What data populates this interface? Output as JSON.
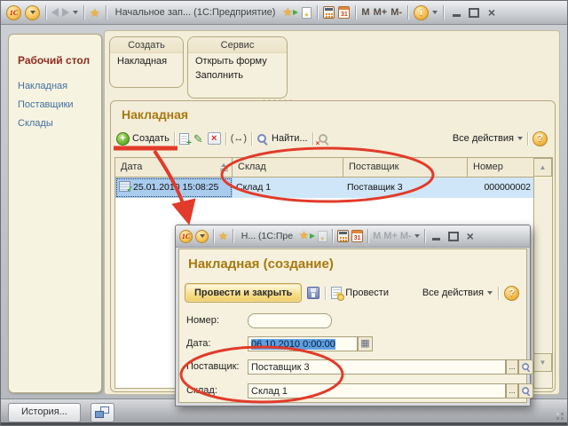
{
  "icons": {
    "logo": "1С",
    "calendar_day": "31",
    "ellipsis": "...",
    "close": "×",
    "help": "?",
    "info": "i",
    "grid": "▦",
    "resize_hint": "(↔)"
  },
  "window": {
    "title": "Начальное зап... (1С:Предприятие)",
    "m_buttons": [
      "M",
      "M+",
      "M-"
    ],
    "statusbar": {
      "history_label": "История..."
    }
  },
  "sidebar": {
    "title": "Рабочий стол",
    "links": [
      "Накладная",
      "Поставщики",
      "Склады"
    ]
  },
  "command_groups": [
    {
      "title": "Создать",
      "items": [
        "Накладная"
      ]
    },
    {
      "title": "Сервис",
      "items": [
        "Открыть форму",
        "Заполнить"
      ]
    }
  ],
  "list_panel": {
    "title": "Накладная",
    "toolbar": {
      "create_label": "Создать",
      "find_label": "Найти...",
      "all_actions_label": "Все действия"
    },
    "table": {
      "columns": [
        "Дата",
        "Склад",
        "Поставщик",
        "Номер"
      ],
      "row": {
        "date": "25.01.2010 15:08:25",
        "warehouse": "Склад 1",
        "supplier": "Поставщик 3",
        "number": "000000002"
      }
    }
  },
  "dialog": {
    "title": "Н... (1С:Пре",
    "m_buttons": [
      "M",
      "M+",
      "M-"
    ],
    "heading": "Накладная (создание)",
    "toolbar": {
      "post_close_label": "Провести и закрыть",
      "post_label": "Провести",
      "all_actions_label": "Все действия"
    },
    "fields": {
      "number": {
        "label": "Номер:",
        "value": ""
      },
      "date": {
        "label": "Дата:",
        "value": "06.10.2010 0:00:00"
      },
      "supplier": {
        "label": "Поставщик:",
        "value": "Поставщик 3"
      },
      "warehouse": {
        "label": "Склад:",
        "value": "Склад 1"
      }
    }
  },
  "colors": {
    "accent_gold": "#a8790f",
    "annotation_red": "#e23b2a",
    "link_blue": "#41709e",
    "section_maroon": "#8f2b1e",
    "selection_blue": "#cfe6f8",
    "focus_cell_blue": "#a9cbee"
  }
}
